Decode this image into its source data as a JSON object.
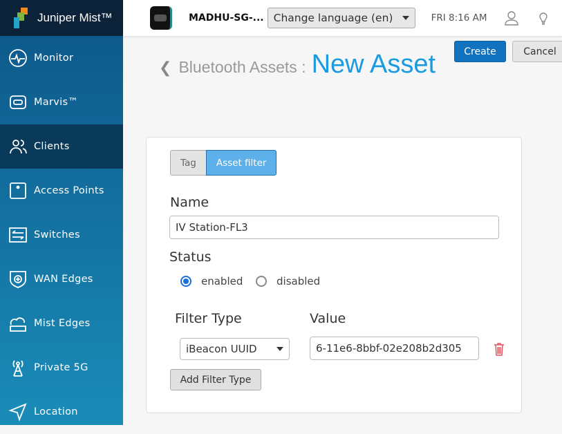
{
  "logo": {
    "text": "Juniper Mist™"
  },
  "sidebar": {
    "items": [
      {
        "label": "Monitor",
        "icon": "monitor-icon"
      },
      {
        "label": "Marvis™",
        "icon": "marvis-icon"
      },
      {
        "label": "Clients",
        "icon": "clients-icon",
        "active": true
      },
      {
        "label": "Access Points",
        "icon": "access-point-icon"
      },
      {
        "label": "Switches",
        "icon": "switches-icon"
      },
      {
        "label": "WAN Edges",
        "icon": "wan-edges-icon"
      },
      {
        "label": "Mist Edges",
        "icon": "mist-edges-icon"
      },
      {
        "label": "Private 5G",
        "icon": "antenna-icon"
      },
      {
        "label": "Location",
        "icon": "location-icon"
      }
    ]
  },
  "header": {
    "org": "MADHU-SG-...",
    "language": "Change language (en)",
    "time": "FRI 8:16 AM"
  },
  "actions": {
    "create": "Create",
    "cancel": "Cancel"
  },
  "title": {
    "breadcrumb": "Bluetooth Assets :",
    "page": "New Asset"
  },
  "form": {
    "tabs": [
      "Tag",
      "Asset filter"
    ],
    "active_tab": "Asset filter",
    "name_label": "Name",
    "name_value": "IV Station-FL3",
    "status_label": "Status",
    "status_options": [
      "enabled",
      "disabled"
    ],
    "status_selected": "enabled",
    "filter_type_label": "Filter Type",
    "value_label": "Value",
    "filter_type": "iBeacon UUID",
    "filter_value": "6-11e6-8bbf-02e208b2d305",
    "add_filter": "Add Filter Type"
  },
  "colors": {
    "accent": "#1a9ae0",
    "primary_button": "#1172c0",
    "delete": "#e0505a"
  }
}
